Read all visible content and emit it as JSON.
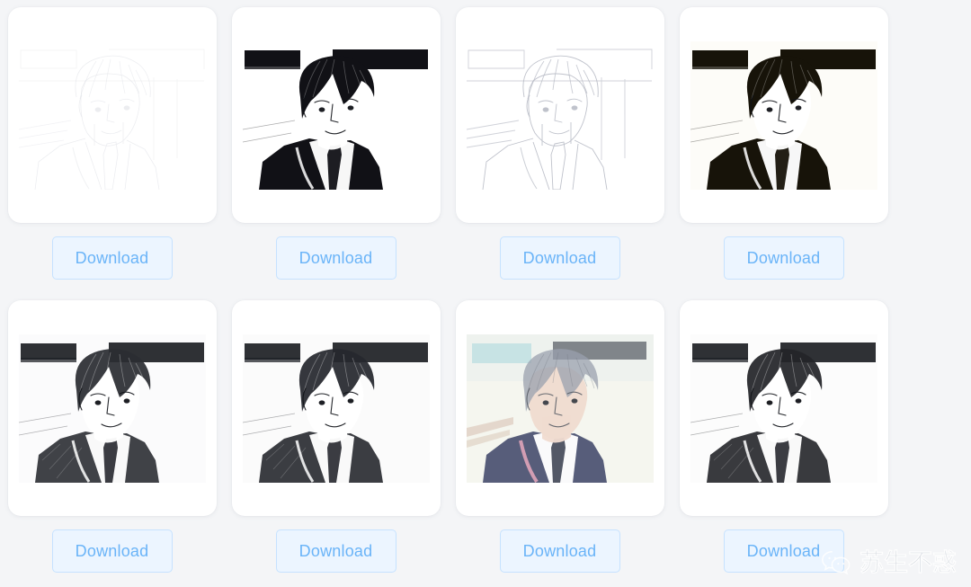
{
  "page": {
    "background_color": "#f4f5f7",
    "card_background": "#ffffff",
    "accent_color": "#6ab4f8",
    "button_fill": "#ecf5ff",
    "button_border": "#c6e2ff",
    "columns": 4,
    "rows": 2
  },
  "watermark": {
    "text": "苏生不惑",
    "icon": "wechat-bubble-icon"
  },
  "results": [
    {
      "id": 1,
      "style_name": "faint-pencil-outline",
      "download_label": "Download",
      "render": {
        "mode": "sketch",
        "stroke": "#dcdee4",
        "stroke_width": 0.75,
        "background": "#ffffff",
        "detail": "very-light"
      }
    },
    {
      "id": 2,
      "style_name": "high-contrast-ink",
      "download_label": "Download",
      "render": {
        "mode": "ink",
        "stroke": "#101014",
        "fill_dark": "#111116",
        "background": "#ffffff",
        "detail": "bold"
      }
    },
    {
      "id": 3,
      "style_name": "graphite-pencil-outline",
      "download_label": "Download",
      "render": {
        "mode": "sketch",
        "stroke": "#b9bcc6",
        "stroke_width": 0.9,
        "background": "#ffffff",
        "detail": "light"
      }
    },
    {
      "id": 4,
      "style_name": "threshold-black-white",
      "download_label": "Download",
      "render": {
        "mode": "ink",
        "stroke": "#14110c",
        "fill_dark": "#171309",
        "background": "#fdfcf8",
        "detail": "solid"
      }
    },
    {
      "id": 5,
      "style_name": "charcoal-grayscale",
      "download_label": "Download",
      "render": {
        "mode": "gray",
        "stroke": "#24262b",
        "fill_dark": "#2b2d33",
        "background": "#fbfbfc",
        "detail": "medium"
      }
    },
    {
      "id": 6,
      "style_name": "pencil-shading-grayscale",
      "download_label": "Download",
      "render": {
        "mode": "gray",
        "stroke": "#1e2025",
        "fill_dark": "#26282e",
        "background": "#fbfbfb",
        "detail": "medium"
      }
    },
    {
      "id": 7,
      "style_name": "color-pencil-watercolor",
      "download_label": "Download",
      "render": {
        "mode": "color",
        "stroke": "#8d8f99",
        "fill_dark": "#41486a",
        "background": "#f7f8f2",
        "accent_cyan": "#bfe0e2",
        "accent_pink": "#e8a8bd",
        "detail": "soft"
      }
    },
    {
      "id": 8,
      "style_name": "hatched-grayscale",
      "download_label": "Download",
      "render": {
        "mode": "gray",
        "stroke": "#1a1c20",
        "fill_dark": "#232529",
        "background": "#fcfcfc",
        "detail": "medium"
      }
    }
  ]
}
